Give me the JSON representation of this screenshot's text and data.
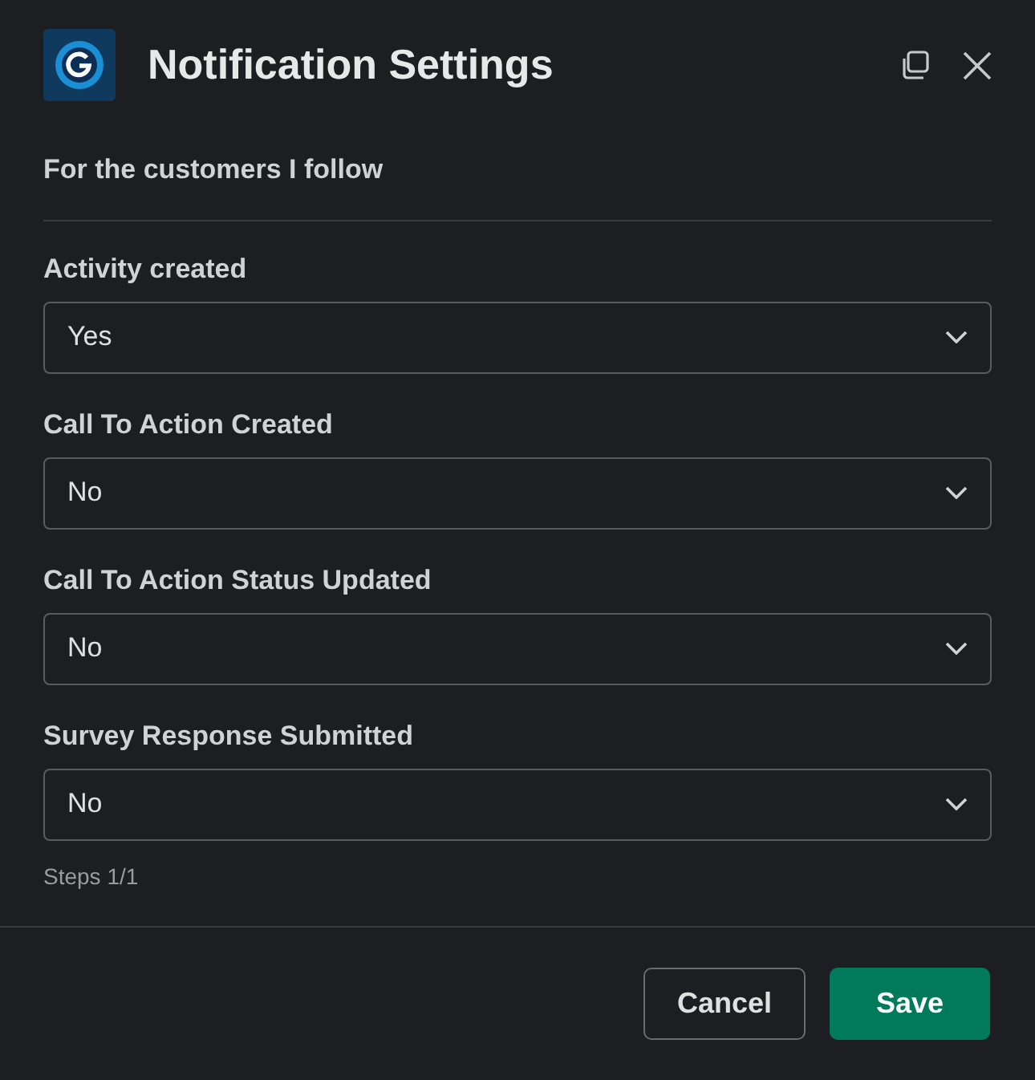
{
  "window": {
    "title": "Notification Settings"
  },
  "section_title": "For the customers I follow",
  "fields": [
    {
      "label": "Activity created",
      "value": "Yes"
    },
    {
      "label": "Call To Action Created",
      "value": "No"
    },
    {
      "label": "Call To Action Status Updated",
      "value": "No"
    },
    {
      "label": "Survey Response Submitted",
      "value": "No"
    }
  ],
  "steps": "Steps 1/1",
  "buttons": [
    {
      "label": "Cancel",
      "kind": "secondary"
    },
    {
      "label": "Save",
      "kind": "primary"
    }
  ]
}
